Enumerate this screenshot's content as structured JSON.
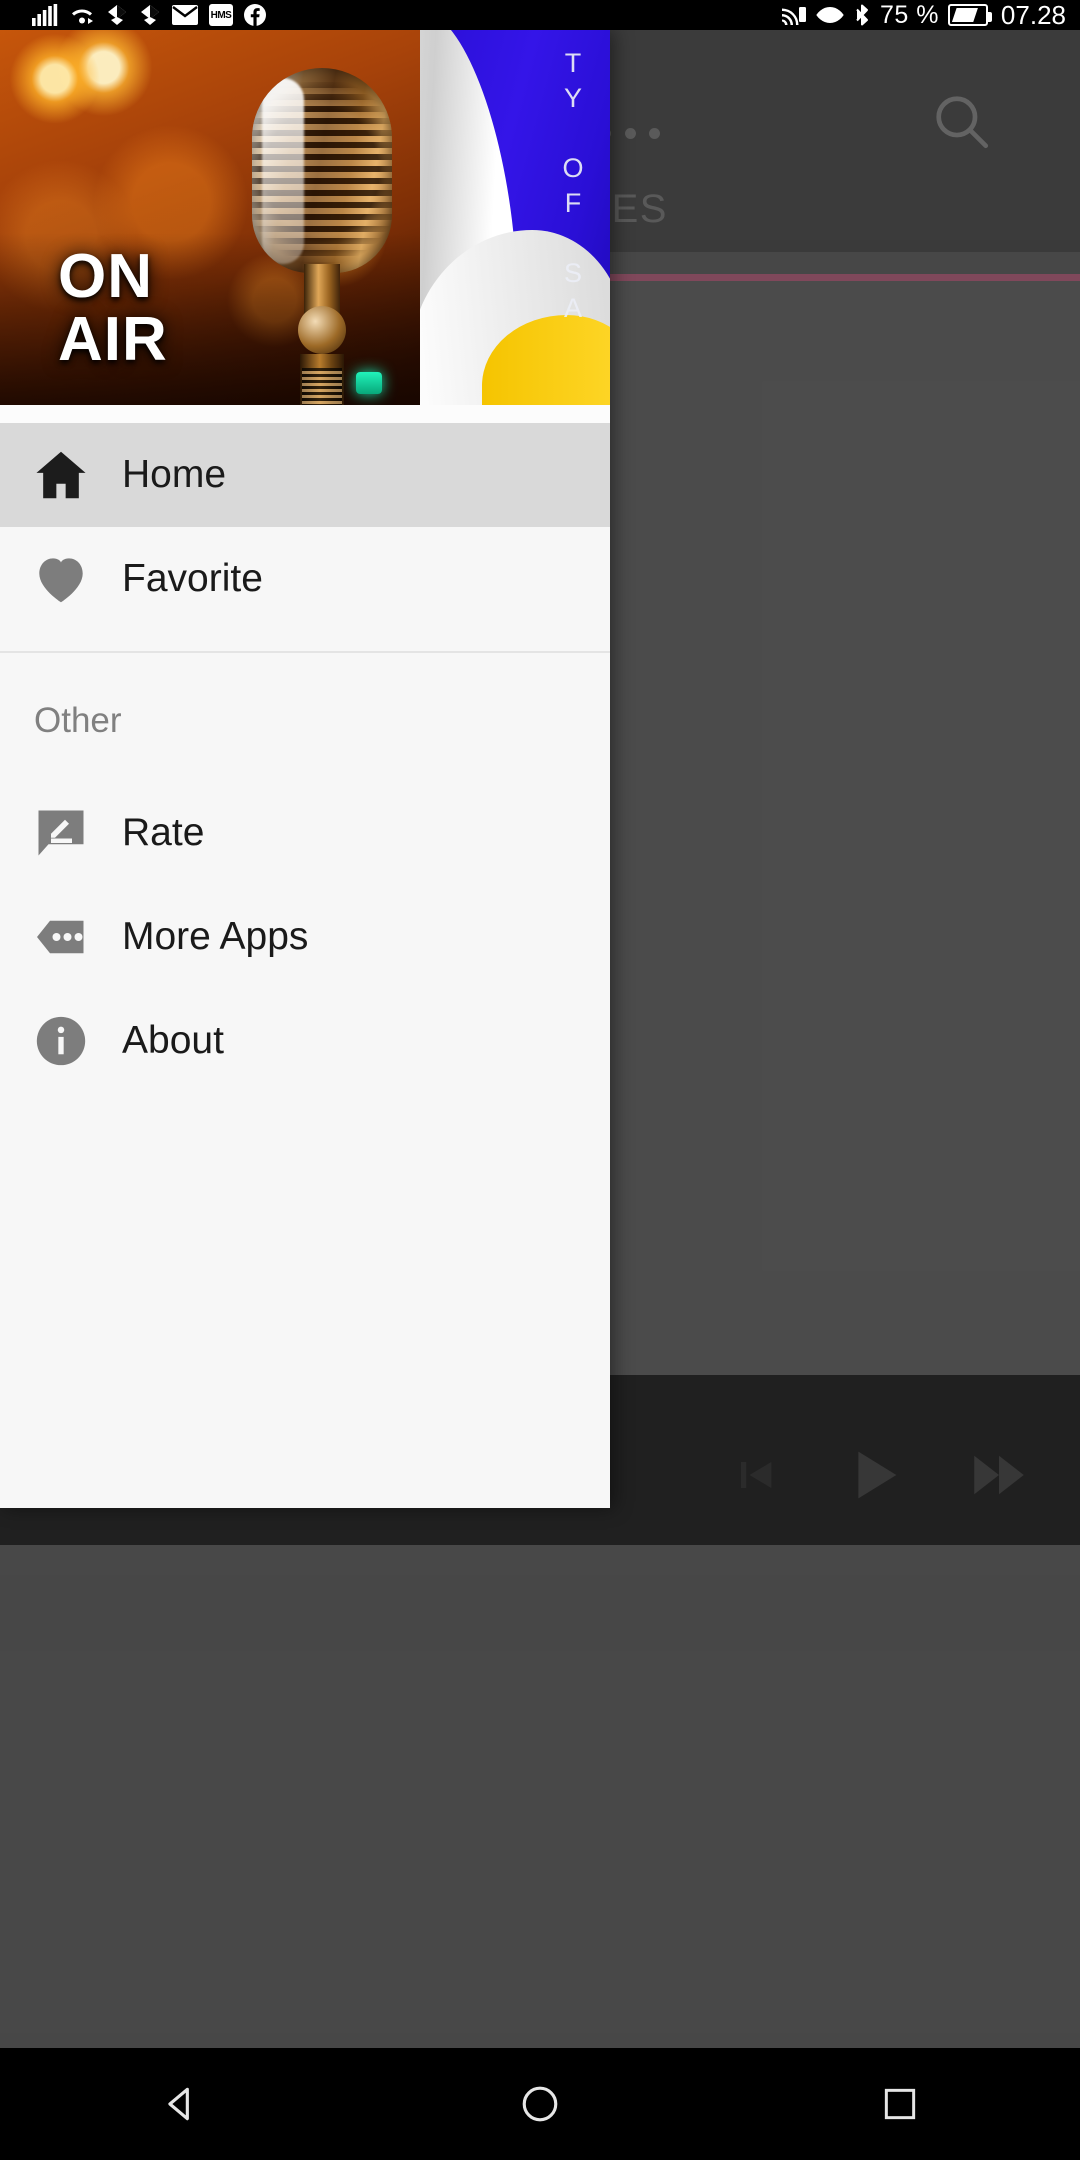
{
  "status_bar": {
    "left_icons": [
      "signal-bars-icon",
      "wifi-icon",
      "dropbox-sync-icon",
      "dropbox-sync-icon-2",
      "mail-icon",
      "hms-icon",
      "facebook-icon"
    ],
    "hms_label": "HMS",
    "right_icons": [
      "cast-icon",
      "eye-icon",
      "bluetooth-icon",
      "battery-icon"
    ],
    "battery_percent": "75 %",
    "clock": "07.28"
  },
  "drawer": {
    "header": {
      "image_name": "on-air-microphone-banner",
      "on_air_line1": "ON",
      "on_air_line2": "AIR",
      "flag_text": "TY OF SA"
    },
    "primary_items": [
      {
        "id": "home",
        "label": "Home",
        "icon": "home-icon",
        "selected": true
      },
      {
        "id": "favorite",
        "label": "Favorite",
        "icon": "heart-icon",
        "selected": false
      }
    ],
    "section_label": "Other",
    "other_items": [
      {
        "id": "rate",
        "label": "Rate",
        "icon": "rate-review-icon"
      },
      {
        "id": "more-apps",
        "label": "More Apps",
        "icon": "more-apps-tag-icon"
      },
      {
        "id": "about",
        "label": "About",
        "icon": "info-circle-icon"
      }
    ]
  },
  "app_behind": {
    "toolbar": {
      "overflow_icon": "overflow-menu-icon",
      "search_icon": "search-icon"
    },
    "tab_label": "ORIES",
    "player": {
      "previous_icon": "skip-previous-icon",
      "play_icon": "play-icon",
      "forward_icon": "fast-forward-icon"
    }
  },
  "system_nav": {
    "back": "back-triangle-icon",
    "home": "home-circle-icon",
    "recents": "recents-square-icon"
  },
  "colors": {
    "drawer_bg": "#f7f7f7",
    "selected_row": "#d9d9d9",
    "tab_indicator": "#9e0b3d",
    "icon_gray": "#808080",
    "text_dark": "#1a1a1a"
  }
}
